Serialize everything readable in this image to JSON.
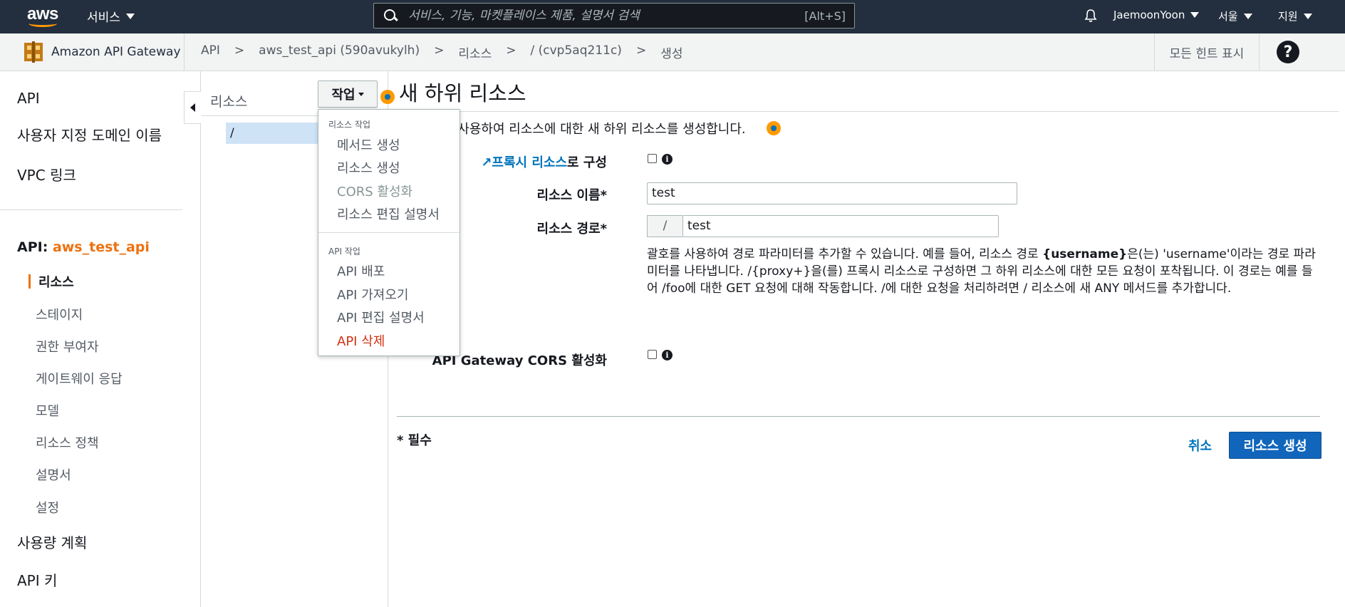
{
  "topnav": {
    "services_label": "서비스",
    "search_placeholder": "서비스, 기능, 마켓플레이스 제품, 설명서 검색",
    "search_shortcut": "[Alt+S]",
    "user": "JaemoonYoon",
    "region": "서울",
    "support": "지원"
  },
  "subbar": {
    "service_name": "Amazon API Gateway",
    "breadcrumbs": [
      "API",
      ">",
      "aws_test_api (590avukylh)",
      ">",
      "리소스",
      ">",
      "/ (cvp5aq211c)",
      ">",
      "생성"
    ],
    "hints_label": "모든 힌트 표시",
    "help_label": "?"
  },
  "leftnav": {
    "items_top": [
      "API",
      "사용자 지정 도메인 이름",
      "VPC 링크"
    ],
    "api_prefix": "API:",
    "api_name": "aws_test_api",
    "active_item": "리소스",
    "sub_items": [
      "스테이지",
      "권한 부여자",
      "게이트웨이 응답",
      "모델",
      "리소스 정책",
      "설명서",
      "설정"
    ],
    "items_bottom": [
      "사용량 계획",
      "API 키"
    ]
  },
  "tree": {
    "header": "리소스",
    "actions_label": "작업",
    "root": "/"
  },
  "dropdown": {
    "resource_header": "리소스 작업",
    "resource_items": [
      "메서드 생성",
      "리소스 생성",
      "CORS 활성화",
      "리소스 편집 설명서"
    ],
    "api_header": "API 작업",
    "api_items": [
      "API 배포",
      "API 가져오기",
      "API 편집 설명서",
      "API 삭제"
    ]
  },
  "form": {
    "title": "새 하위 리소스",
    "intro": "을 사용하여 리소스에 대한 새 하위 리소스를 생성합니다.",
    "proxy_link": "프록시 리소스",
    "proxy_suffix": "로 구성",
    "name_label": "리소스 이름*",
    "name_value": "test",
    "path_label": "리소스 경로*",
    "path_prefix": "/",
    "path_value": "test",
    "help_1": "괄호를 사용하여 경로 파라미터를 추가할 수 있습니다. 예를 들어, 리소스 경로 ",
    "help_bold": "{username}",
    "help_2": "은(는) 'username'이라는 경로 파라미터를 나타냅니다. /{proxy+}을(를) 프록시 리소스로 구성하면 그 하위 리소스에 대한 모든 요청이 포착됩니다. 이 경로는 예를 들어 /foo에 대한 GET 요청에 대해 작동합니다. /에 대한 요청을 처리하려면 / 리소스에 새 ANY 메서드를 추가합니다.",
    "cors_label": "API Gateway CORS 활성화",
    "required_note": "* 필수",
    "cancel_label": "취소",
    "create_label": "리소스 생성"
  }
}
